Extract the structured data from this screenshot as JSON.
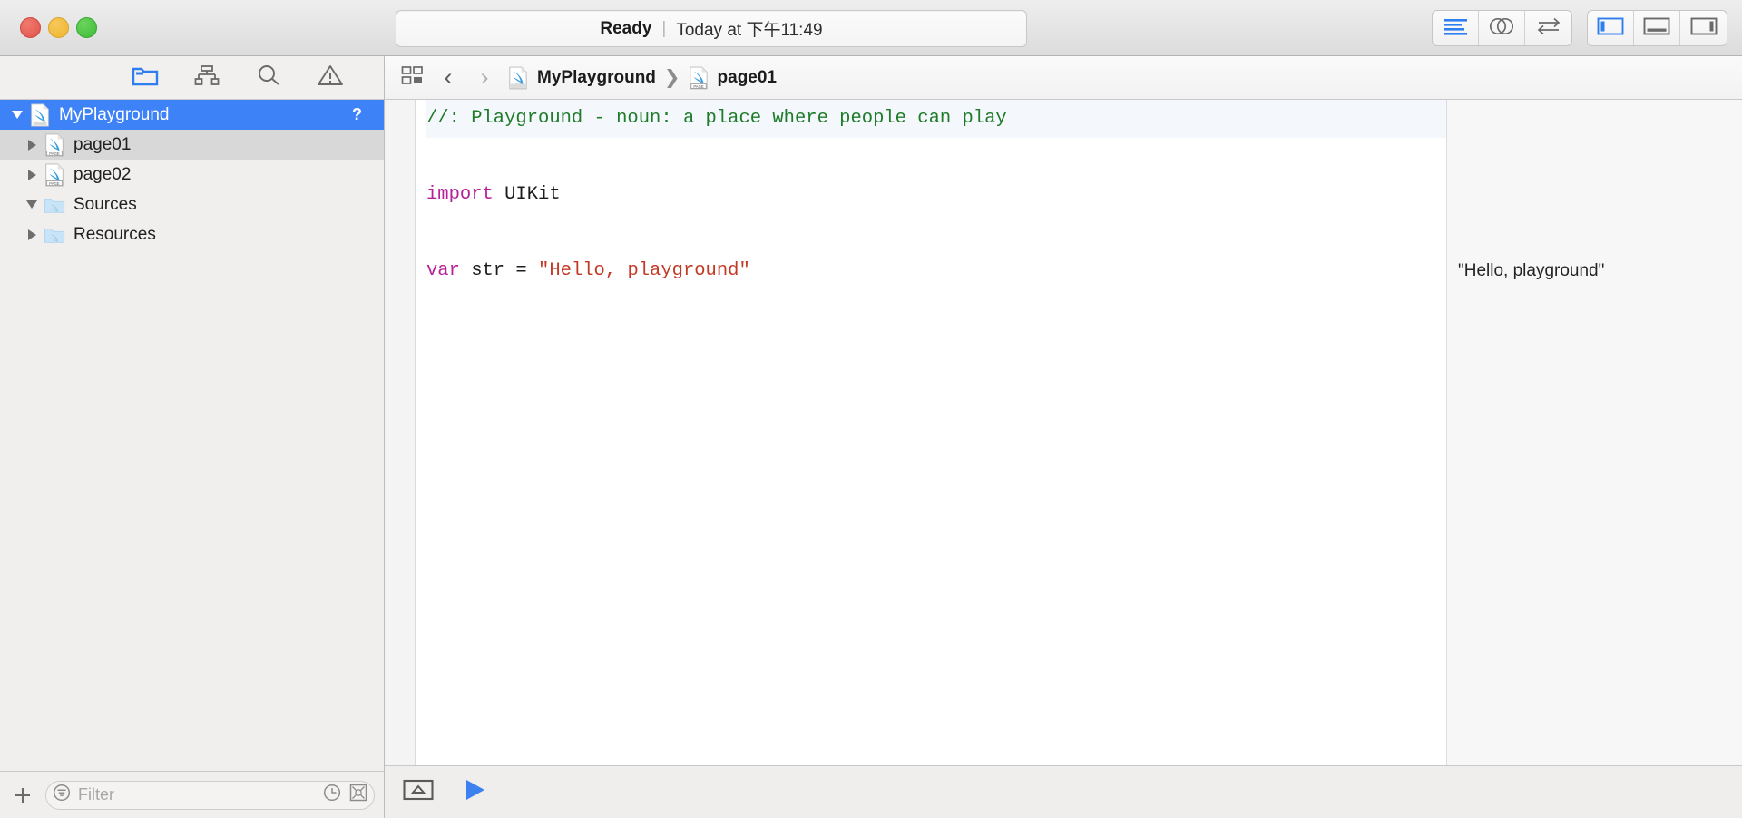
{
  "window": {
    "traffic_lights": [
      "close",
      "minimize",
      "maximize"
    ],
    "colors": {
      "accent_blue": "#3e82f7",
      "selection_blue": "#3e82f7",
      "comment_green": "#1e7c29",
      "keyword_magenta": "#b5219b",
      "string_red": "#c23a26",
      "run_blue": "#3b82f0"
    }
  },
  "toolbar": {
    "status": {
      "state": "Ready",
      "separator": "|",
      "timestamp": "Today at 下午11:49"
    },
    "right_buttons": [
      {
        "name": "standard-editor-button",
        "icon": "lines-icon",
        "active": true
      },
      {
        "name": "version-editor-button",
        "icon": "venn-circles-icon",
        "active": false
      },
      {
        "name": "assistant-editor-button",
        "icon": "swap-arrows-icon",
        "active": false
      },
      {
        "name": "navigator-toggle-button",
        "icon": "left-panel-icon",
        "active": true
      },
      {
        "name": "debug-area-toggle-button",
        "icon": "bottom-panel-icon",
        "active": false
      },
      {
        "name": "utilities-toggle-button",
        "icon": "right-panel-icon",
        "active": false
      }
    ]
  },
  "navigator": {
    "tabs": [
      {
        "name": "project-navigator-tab",
        "icon": "folder-icon",
        "active": true
      },
      {
        "name": "symbol-navigator-tab",
        "icon": "hierarchy-icon",
        "active": false
      },
      {
        "name": "find-navigator-tab",
        "icon": "search-icon",
        "active": false
      },
      {
        "name": "issue-navigator-tab",
        "icon": "warning-triangle-icon",
        "active": false
      }
    ],
    "tree": [
      {
        "label": "MyPlayground",
        "icon": "swift-playground-icon",
        "disclosure": "down",
        "state": "selected",
        "indent": 0,
        "badge": "?"
      },
      {
        "label": "page01",
        "icon": "swift-page-icon",
        "disclosure": "right",
        "state": "highlighted",
        "indent": 1,
        "badge": ""
      },
      {
        "label": "page02",
        "icon": "swift-page-icon",
        "disclosure": "right",
        "state": "normal",
        "indent": 1,
        "badge": ""
      },
      {
        "label": "Sources",
        "icon": "swift-folder-icon",
        "disclosure": "down",
        "state": "normal",
        "indent": 1,
        "badge": ""
      },
      {
        "label": "Resources",
        "icon": "swift-folder-icon",
        "disclosure": "right",
        "state": "normal",
        "indent": 1,
        "badge": ""
      }
    ],
    "filter_bar": {
      "add_label": "+",
      "placeholder": "Filter",
      "filter_icon": "filter-lines-icon",
      "recents_icon": "clock-icon",
      "source_control_icon": "source-control-filter-icon"
    }
  },
  "jumpbar": {
    "related_items_icon": "related-items-icon",
    "back_label": "‹",
    "forward_label": "›",
    "breadcrumbs": [
      {
        "label": "MyPlayground",
        "icon": "swift-playground-icon"
      },
      {
        "label": "page01",
        "icon": "swift-page-icon"
      }
    ],
    "separator": "❯"
  },
  "editor": {
    "lines": [
      {
        "highlighted": true,
        "tokens": [
          {
            "kind": "comment",
            "text": "//: Playground - noun: a place where people can play"
          }
        ]
      },
      {
        "highlighted": false,
        "tokens": []
      },
      {
        "highlighted": false,
        "tokens": [
          {
            "kind": "kw",
            "text": "import"
          },
          {
            "kind": "plain",
            "text": " UIKit"
          }
        ]
      },
      {
        "highlighted": false,
        "tokens": []
      },
      {
        "highlighted": false,
        "tokens": [
          {
            "kind": "kw",
            "text": "var"
          },
          {
            "kind": "plain",
            "text": " str = "
          },
          {
            "kind": "str",
            "text": "\"Hello, playground\""
          }
        ]
      }
    ],
    "results": [
      "",
      "",
      "",
      "",
      "\"Hello, playground\""
    ],
    "bottom_bar": {
      "debug_toggle_icon": "show-debug-area-icon",
      "run_icon": "play-triangle-icon"
    }
  }
}
